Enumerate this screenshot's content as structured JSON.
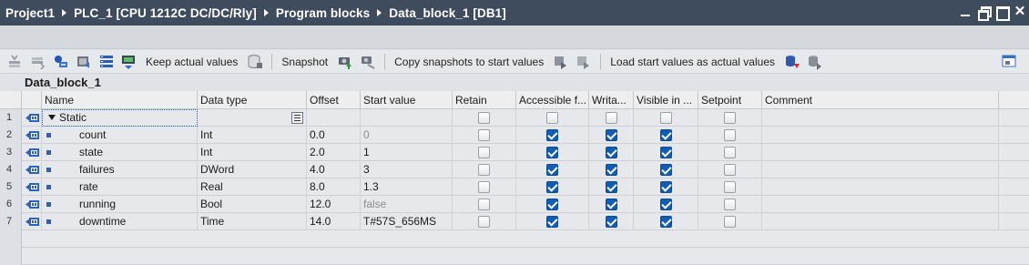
{
  "breadcrumb": [
    "Project1",
    "PLC_1 [CPU 1212C DC/DC/Rly]",
    "Program blocks",
    "Data_block_1 [DB1]"
  ],
  "window_controls": [
    "minimize",
    "restore",
    "maximize",
    "close"
  ],
  "toolbar": {
    "keep_actual_values": "Keep actual values",
    "snapshot": "Snapshot",
    "copy_snapshots": "Copy snapshots to start values",
    "load_start_values": "Load start values as actual values"
  },
  "block_title": "Data_block_1",
  "columns": [
    "Name",
    "Data type",
    "Offset",
    "Start value",
    "Retain",
    "Accessible f...",
    "Writa...",
    "Visible in ...",
    "Setpoint",
    "Comment"
  ],
  "rows": [
    {
      "num": "1",
      "name": "Static",
      "type": "",
      "offset": "",
      "start": "",
      "retain": false,
      "accessible": false,
      "writable": false,
      "visible": false,
      "setpoint": false
    },
    {
      "num": "2",
      "name": "count",
      "type": "Int",
      "offset": "0.0",
      "start": "0",
      "retain": false,
      "accessible": true,
      "writable": true,
      "visible": true,
      "setpoint": false
    },
    {
      "num": "3",
      "name": "state",
      "type": "Int",
      "offset": "2.0",
      "start": "1",
      "retain": false,
      "accessible": true,
      "writable": true,
      "visible": true,
      "setpoint": false
    },
    {
      "num": "4",
      "name": "failures",
      "type": "DWord",
      "offset": "4.0",
      "start": "3",
      "retain": false,
      "accessible": true,
      "writable": true,
      "visible": true,
      "setpoint": false
    },
    {
      "num": "5",
      "name": "rate",
      "type": "Real",
      "offset": "8.0",
      "start": "1.3",
      "retain": false,
      "accessible": true,
      "writable": true,
      "visible": true,
      "setpoint": false
    },
    {
      "num": "6",
      "name": "running",
      "type": "Bool",
      "offset": "12.0",
      "start": "false",
      "retain": false,
      "accessible": true,
      "writable": true,
      "visible": true,
      "setpoint": false
    },
    {
      "num": "7",
      "name": "downtime",
      "type": "Time",
      "offset": "14.0",
      "start": "T#57S_656MS",
      "retain": false,
      "accessible": true,
      "writable": true,
      "visible": true,
      "setpoint": false
    }
  ],
  "colors": {
    "titlebar": "#3f4c5e",
    "checkbox_on": "#0f5db5",
    "bullet": "#2d5fb5"
  }
}
